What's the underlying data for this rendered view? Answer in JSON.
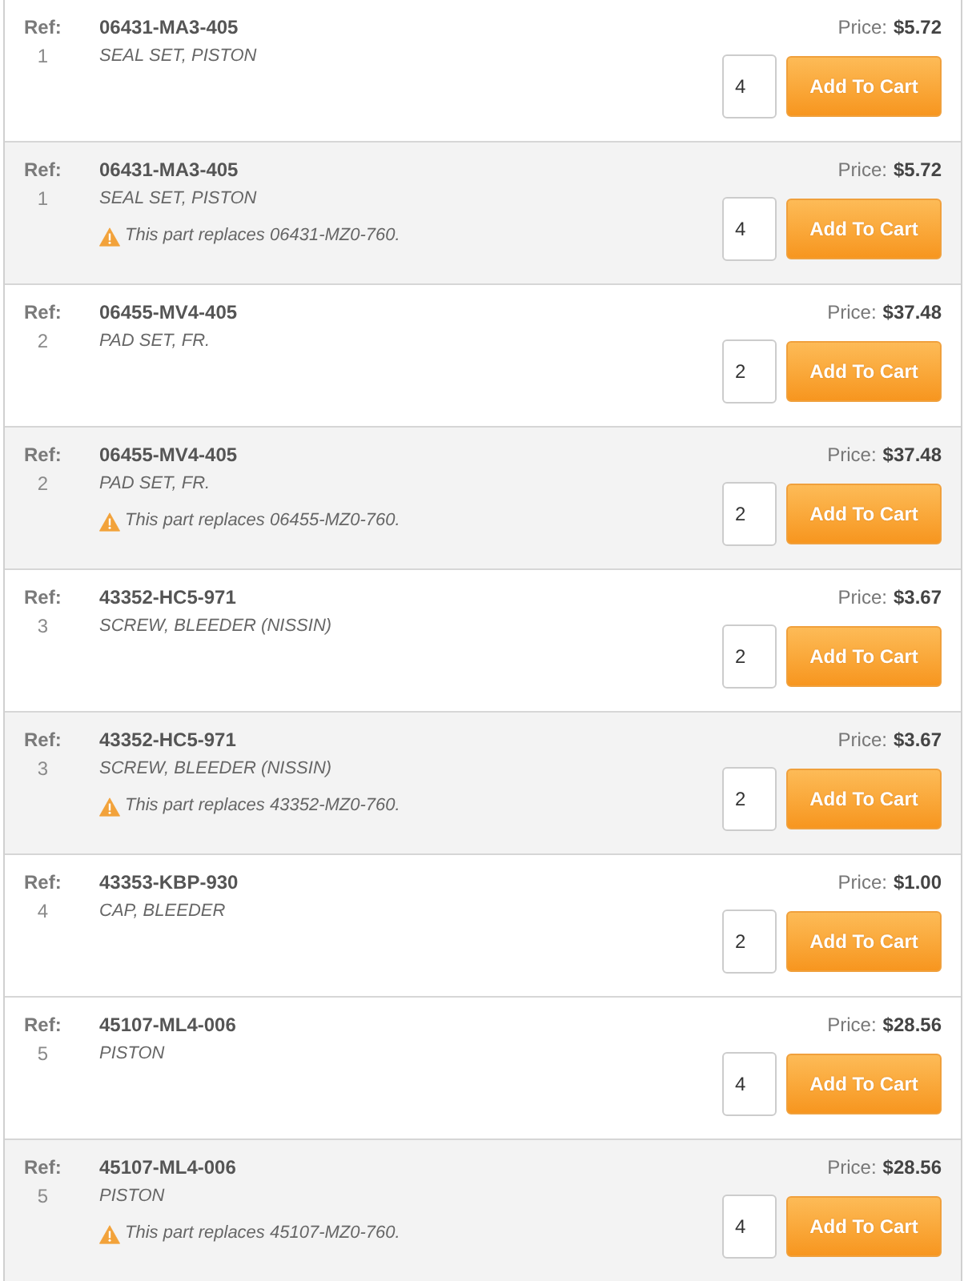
{
  "parts": [
    {
      "ref_label": "Ref:",
      "ref": "1",
      "part_number": "06431-MA3-405",
      "description": "SEAL SET, PISTON",
      "price_label": "Price:",
      "price": "$5.72",
      "quantity": "4",
      "button": "Add To Cart"
    },
    {
      "ref_label": "Ref:",
      "ref": "1",
      "part_number": "06431-MA3-405",
      "description": "SEAL SET, PISTON",
      "notice": "This part replaces 06431-MZ0-760.",
      "price_label": "Price:",
      "price": "$5.72",
      "quantity": "4",
      "button": "Add To Cart"
    },
    {
      "ref_label": "Ref:",
      "ref": "2",
      "part_number": "06455-MV4-405",
      "description": "PAD SET, FR.",
      "price_label": "Price:",
      "price": "$37.48",
      "quantity": "2",
      "button": "Add To Cart"
    },
    {
      "ref_label": "Ref:",
      "ref": "2",
      "part_number": "06455-MV4-405",
      "description": "PAD SET, FR.",
      "notice": "This part replaces 06455-MZ0-760.",
      "price_label": "Price:",
      "price": "$37.48",
      "quantity": "2",
      "button": "Add To Cart"
    },
    {
      "ref_label": "Ref:",
      "ref": "3",
      "part_number": "43352-HC5-971",
      "description": "SCREW, BLEEDER (NISSIN)",
      "price_label": "Price:",
      "price": "$3.67",
      "quantity": "2",
      "button": "Add To Cart"
    },
    {
      "ref_label": "Ref:",
      "ref": "3",
      "part_number": "43352-HC5-971",
      "description": "SCREW, BLEEDER (NISSIN)",
      "notice": "This part replaces 43352-MZ0-760.",
      "price_label": "Price:",
      "price": "$3.67",
      "quantity": "2",
      "button": "Add To Cart"
    },
    {
      "ref_label": "Ref:",
      "ref": "4",
      "part_number": "43353-KBP-930",
      "description": "CAP, BLEEDER",
      "price_label": "Price:",
      "price": "$1.00",
      "quantity": "2",
      "button": "Add To Cart"
    },
    {
      "ref_label": "Ref:",
      "ref": "5",
      "part_number": "45107-ML4-006",
      "description": "PISTON",
      "price_label": "Price:",
      "price": "$28.56",
      "quantity": "4",
      "button": "Add To Cart"
    },
    {
      "ref_label": "Ref:",
      "ref": "5",
      "part_number": "45107-ML4-006",
      "description": "PISTON",
      "notice": "This part replaces 45107-MZ0-760.",
      "price_label": "Price:",
      "price": "$28.56",
      "quantity": "4",
      "button": "Add To Cart"
    }
  ]
}
